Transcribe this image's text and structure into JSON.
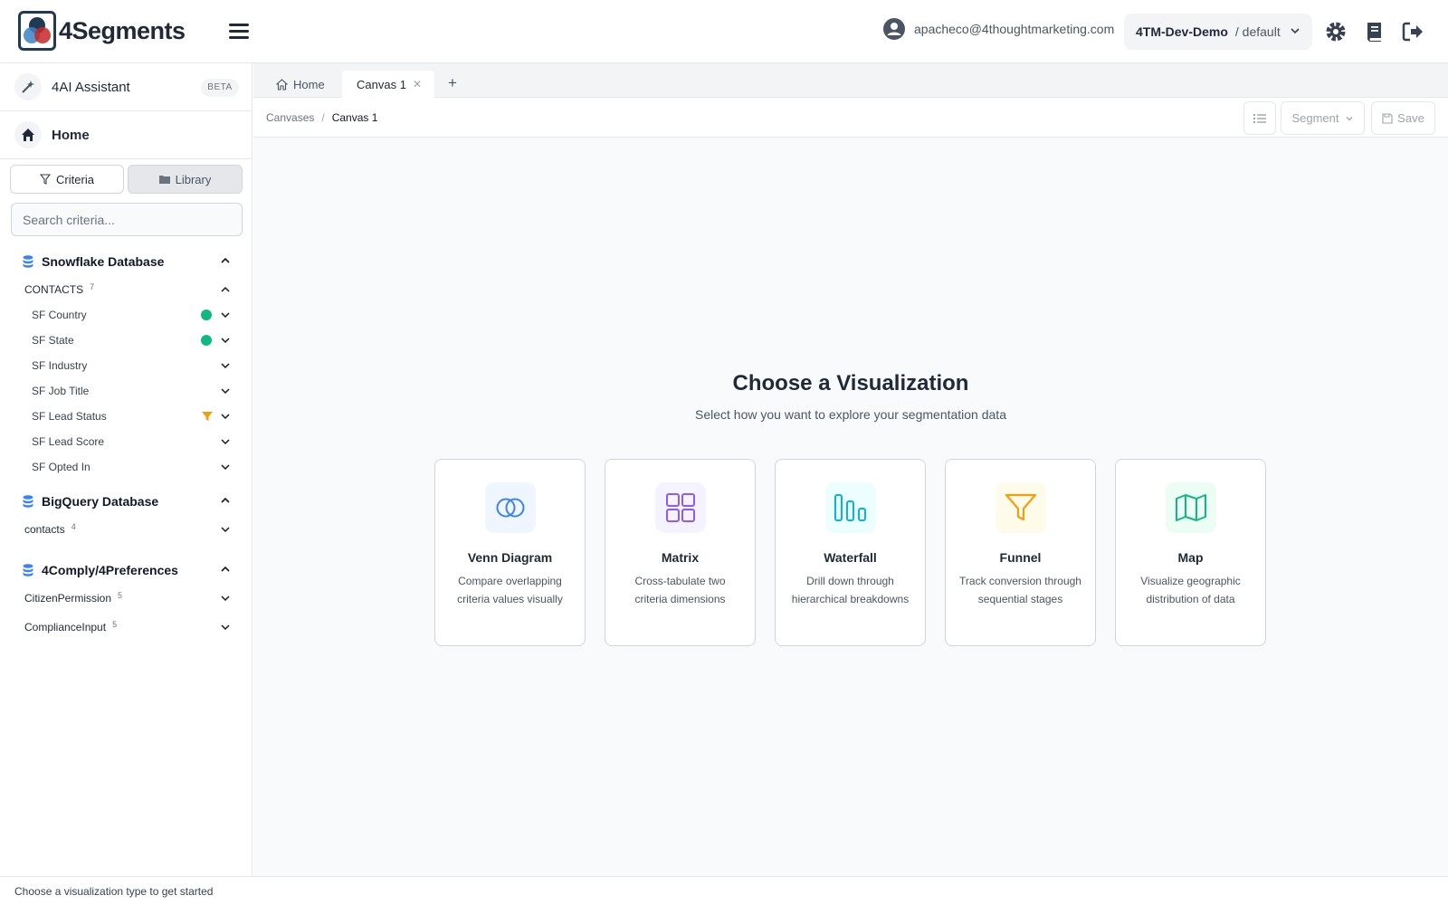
{
  "app": {
    "logo_text": "4Segments"
  },
  "header": {
    "user_email": "apacheco@4thoughtmarketing.com",
    "tenant_name": "4TM-Dev-Demo",
    "tenant_env": "/ default"
  },
  "sidebar": {
    "assistant_label": "4AI Assistant",
    "assistant_badge": "BETA",
    "home_label": "Home",
    "criteria_tab": "Criteria",
    "library_tab": "Library",
    "search_placeholder": "Search criteria...",
    "databases": [
      {
        "name": "Snowflake Database",
        "tables": [
          {
            "name": "CONTACTS",
            "count": "7",
            "fields": [
              {
                "name": "SF Country",
                "badge": "green"
              },
              {
                "name": "SF State",
                "badge": "green"
              },
              {
                "name": "SF Industry",
                "badge": ""
              },
              {
                "name": "SF Job Title",
                "badge": ""
              },
              {
                "name": "SF Lead Status",
                "badge": "filter"
              },
              {
                "name": "SF Lead Score",
                "badge": ""
              },
              {
                "name": "SF Opted In",
                "badge": ""
              }
            ]
          }
        ]
      },
      {
        "name": "BigQuery Database",
        "tables": [
          {
            "name": "contacts",
            "count": "4"
          }
        ]
      },
      {
        "name": "4Comply/4Preferences",
        "tables": [
          {
            "name": "CitizenPermission",
            "count": "5"
          },
          {
            "name": "ComplianceInput",
            "count": "5"
          }
        ]
      }
    ]
  },
  "tabs": [
    {
      "label": "Home"
    },
    {
      "label": "Canvas 1"
    }
  ],
  "breadcrumb": {
    "parent": "Canvases",
    "separator": "/",
    "current": "Canvas 1"
  },
  "toolbar": {
    "segment_label": "Segment",
    "save_label": "Save"
  },
  "main": {
    "title": "Choose a Visualization",
    "subtitle": "Select how you want to explore your segmentation data",
    "cards": [
      {
        "name": "Venn Diagram",
        "desc": "Compare overlapping criteria values visually",
        "icon": "venn-icon",
        "color": "#3b82f6",
        "bg": "#eff6ff"
      },
      {
        "name": "Matrix",
        "desc": "Cross-tabulate two criteria dimensions",
        "icon": "grid-icon",
        "color": "#8b5cf6",
        "bg": "#f5f3ff"
      },
      {
        "name": "Waterfall",
        "desc": "Drill down through hierarchical breakdowns",
        "icon": "bar-chart-icon",
        "color": "#06b6d4",
        "bg": "#ecfeff"
      },
      {
        "name": "Funnel",
        "desc": "Track conversion through sequential stages",
        "icon": "funnel-icon",
        "color": "#f59e0b",
        "bg": "#fffbeb"
      },
      {
        "name": "Map",
        "desc": "Visualize geographic distribution of data",
        "icon": "map-icon",
        "color": "#10b981",
        "bg": "#ecfdf5"
      }
    ]
  },
  "status": {
    "text": "Choose a visualization type to get started"
  },
  "colors": {
    "accent": "#3b82f6",
    "green": "#10b981",
    "orange": "#f59e0b"
  }
}
